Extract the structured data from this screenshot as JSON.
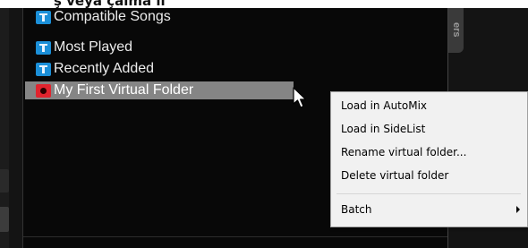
{
  "caption": "ş veya çalma li",
  "side_tab_label": "ers",
  "folders": [
    {
      "label": "Compatible Songs",
      "icon": "filter-folder-icon",
      "color": "#1b8fd8"
    },
    {
      "label": "Most Played",
      "icon": "filter-folder-icon",
      "color": "#1b8fd8"
    },
    {
      "label": "Recently Added",
      "icon": "filter-folder-icon",
      "color": "#1b8fd8"
    },
    {
      "label": "My First Virtual Folder",
      "icon": "virtual-folder-icon",
      "color": "#e0242e",
      "selected": true
    }
  ],
  "context_menu": {
    "items": [
      {
        "label": "Load in AutoMix"
      },
      {
        "label": "Load in SideList"
      },
      {
        "label": "Rename virtual folder..."
      },
      {
        "label": "Delete virtual folder"
      },
      {
        "label": "Batch",
        "submenu": true
      }
    ]
  }
}
